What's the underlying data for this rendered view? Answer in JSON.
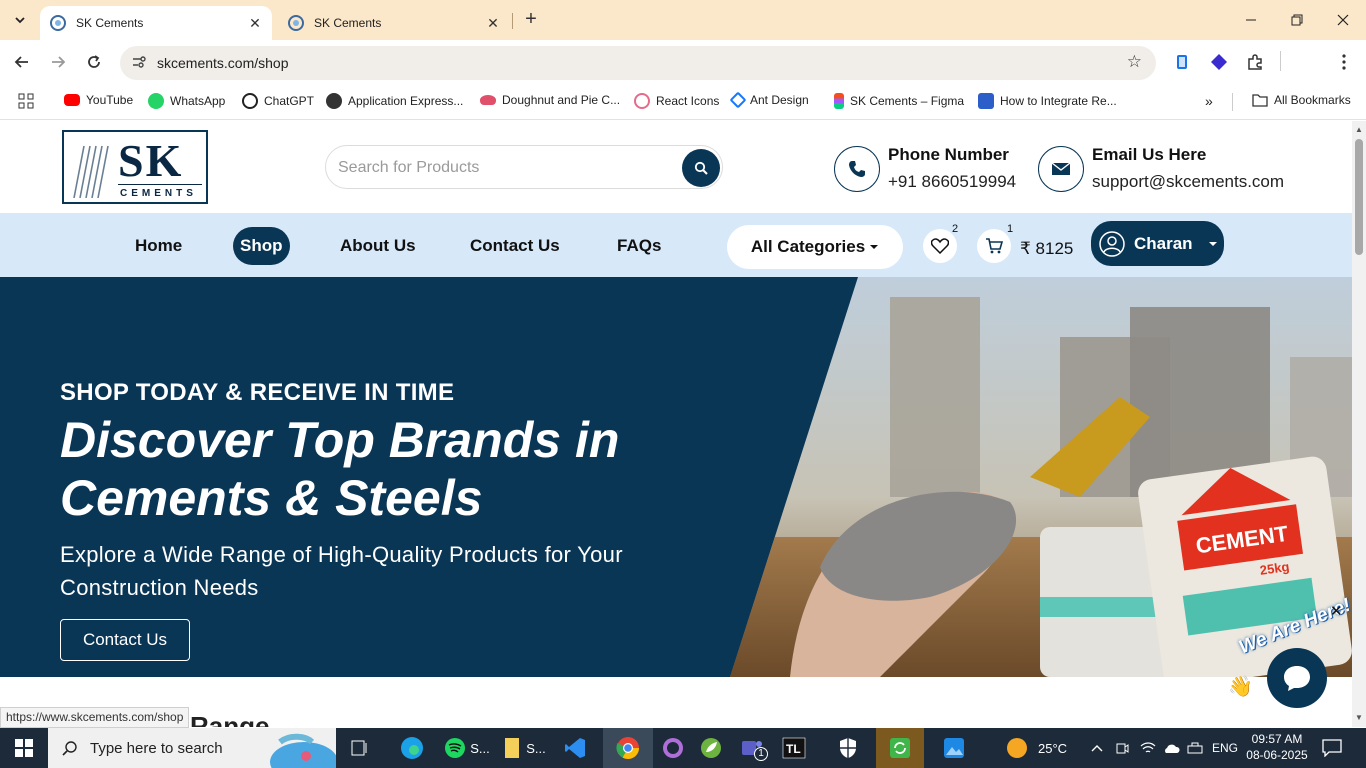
{
  "browser": {
    "tabs": [
      {
        "title": "SK Cements",
        "active": true
      },
      {
        "title": "SK Cements",
        "active": false
      }
    ],
    "url": "skcements.com/shop",
    "profile_initial": "C",
    "extension_badge": "8",
    "bookmarks": [
      {
        "label": "YouTube",
        "color": "#ff0000"
      },
      {
        "label": "WhatsApp",
        "color": "#25d366"
      },
      {
        "label": "ChatGPT",
        "color": "#222222"
      },
      {
        "label": "Application Express...",
        "color": "#333333"
      },
      {
        "label": "Doughnut and Pie C...",
        "color": "#e0506a"
      },
      {
        "label": "React Icons",
        "color": "#e56b8a"
      },
      {
        "label": "Ant Design",
        "color": "#1677ff"
      },
      {
        "label": "SK Cements – Figma",
        "color": "#f24e1e"
      },
      {
        "label": "How to Integrate Re...",
        "color": "#2b5ec9"
      }
    ],
    "all_bookmarks": "All Bookmarks",
    "status_url": "https://www.skcements.com/shop"
  },
  "site": {
    "logo": {
      "initials": "SK",
      "word": "CEMENTS"
    },
    "search": {
      "placeholder": "Search for Products"
    },
    "phone": {
      "title": "Phone Number",
      "value": "+91 8660519994"
    },
    "email": {
      "title": "Email Us Here",
      "value": "support@skcements.com"
    },
    "nav": {
      "links": [
        "Home",
        "Shop",
        "About Us",
        "Contact Us",
        "FAQs"
      ],
      "active": "Shop",
      "categories": "All Categories",
      "wishlist_count": "2",
      "cart_count": "1",
      "cart_total": "₹ 8125",
      "user": "Charan"
    },
    "hero": {
      "kicker": "SHOP TODAY & RECEIVE IN TIME",
      "title": "Discover Top Brands in Cements & Steels",
      "subtitle": "Explore a Wide Range of High-Quality Products for Your Construction Needs",
      "button": "Contact Us",
      "bag_text": "CEMENT",
      "bag_weight": "25kg"
    },
    "section_peek": "Range",
    "chat": {
      "label": "We Are Here!"
    }
  },
  "taskbar": {
    "search_placeholder": "Type here to search",
    "spotify_label": "S...",
    "files_label": "S...",
    "teams_badge": "1",
    "weather": "25°C",
    "language": "ENG",
    "time": "09:57 AM",
    "date": "08-06-2025"
  },
  "colors": {
    "brand": "#0a3656",
    "nav_bg": "#d7e8f9",
    "tabstrip": "#fbe7c9"
  }
}
